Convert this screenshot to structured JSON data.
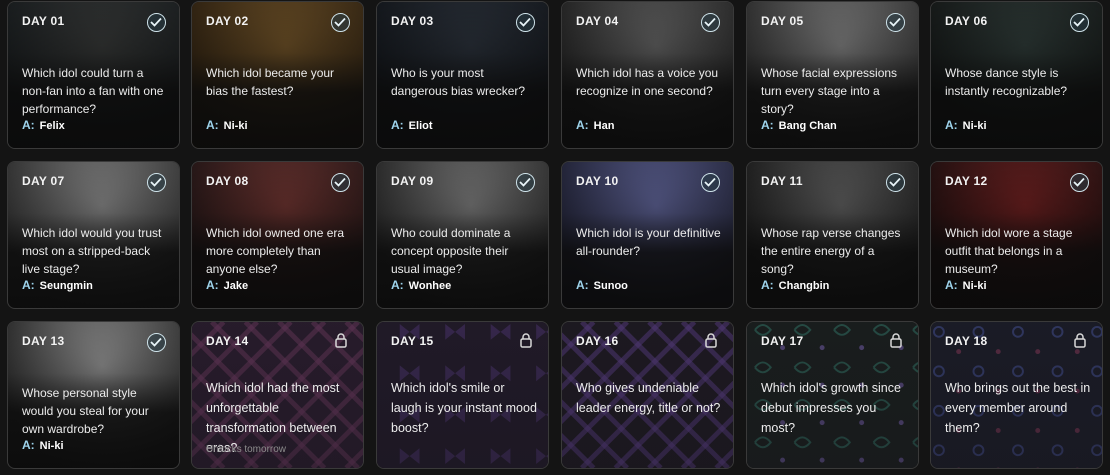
{
  "cards": [
    {
      "day": "DAY 01",
      "question": "Which idol could turn a non-fan into a fan with one performance?",
      "answer_label": "A:",
      "answer": "Felix",
      "status": "completed",
      "icon": "check-icon",
      "bg": "#3b3d3c",
      "bg2": "#1e2224"
    },
    {
      "day": "DAY 02",
      "question": "Which idol became your bias the fastest?",
      "answer_label": "A:",
      "answer": "Ni-ki",
      "status": "completed",
      "icon": "check-icon",
      "bg": "#7a5a2c",
      "bg2": "#3a2a16"
    },
    {
      "day": "DAY 03",
      "question": "Who is your most dangerous bias wrecker?",
      "answer_label": "A:",
      "answer": "Eliot",
      "status": "completed",
      "icon": "check-icon",
      "bg": "#2f3640",
      "bg2": "#181c22"
    },
    {
      "day": "DAY 04",
      "question": "Which idol has a voice you recognize in one second?",
      "answer_label": "A:",
      "answer": "Han",
      "status": "completed",
      "icon": "check-icon",
      "bg": "#6e6e6e",
      "bg2": "#2c2c2c"
    },
    {
      "day": "DAY 05",
      "question": "Whose facial expressions turn every stage into a story?",
      "answer_label": "A:",
      "answer": "Bang Chan",
      "status": "completed",
      "icon": "check-icon",
      "bg": "#8e8e8e",
      "bg2": "#3a3a3a"
    },
    {
      "day": "DAY 06",
      "question": "Whose dance style is instantly recognizable?",
      "answer_label": "A:",
      "answer": "Ni-ki",
      "status": "completed",
      "icon": "check-icon",
      "bg": "#33403d",
      "bg2": "#1a1e1d"
    },
    {
      "day": "DAY 07",
      "question": "Which idol would you trust most on a stripped-back live stage?",
      "answer_label": "A:",
      "answer": "Seungmin",
      "status": "completed",
      "icon": "check-icon",
      "bg": "#9a9a9a",
      "bg2": "#3e3e3e"
    },
    {
      "day": "DAY 08",
      "question": "Which idol owned one era more completely than anyone else?",
      "answer_label": "A:",
      "answer": "Jake",
      "status": "completed",
      "icon": "check-icon",
      "bg": "#7a3a36",
      "bg2": "#2e1c1c"
    },
    {
      "day": "DAY 09",
      "question": "Who could dominate a concept opposite their usual image?",
      "answer_label": "A:",
      "answer": "Wonhee",
      "status": "completed",
      "icon": "check-icon",
      "bg": "#8a8a8a",
      "bg2": "#343434"
    },
    {
      "day": "DAY 10",
      "question": "Which idol is your definitive all-rounder?",
      "answer_label": "A:",
      "answer": "Sunoo",
      "status": "completed",
      "icon": "check-icon",
      "bg": "#6a6fa8",
      "bg2": "#2a2c44"
    },
    {
      "day": "DAY 11",
      "question": "Whose rap verse changes the entire energy of a song?",
      "answer_label": "A:",
      "answer": "Changbin",
      "status": "completed",
      "icon": "check-icon",
      "bg": "#6a6a6a",
      "bg2": "#262626"
    },
    {
      "day": "DAY 12",
      "question": "Which idol wore a stage outfit that belongs in a museum?",
      "answer_label": "A:",
      "answer": "Ni-ki",
      "status": "completed",
      "icon": "check-icon",
      "bg": "#7a2424",
      "bg2": "#2a1414"
    },
    {
      "day": "DAY 13",
      "question": "Whose personal style would you steal for your own wardrobe?",
      "answer_label": "A:",
      "answer": "Ni-ki",
      "status": "completed",
      "icon": "check-icon",
      "bg": "#a8a8a8",
      "bg2": "#3a3a3a"
    },
    {
      "day": "DAY 14",
      "question": "Which idol had the most unforgettable transformation between eras?",
      "note": "Unlocks tomorrow",
      "status": "locked",
      "icon": "lock-icon",
      "pattern": "diamond",
      "bg": "#2a1d2e",
      "accent": "#6b3a5e"
    },
    {
      "day": "DAY 15",
      "question": "Which idol's smile or laugh is your instant mood boost?",
      "status": "locked",
      "icon": "lock-icon",
      "pattern": "bow",
      "bg": "#221b2a",
      "accent": "#5a3f86"
    },
    {
      "day": "DAY 16",
      "question": "Who gives undeniable leader energy, title or not?",
      "status": "locked",
      "icon": "lock-icon",
      "pattern": "lattice",
      "bg": "#1e1a22",
      "accent": "#5a3f86"
    },
    {
      "day": "DAY 17",
      "question": "Which idol's growth since debut impresses you most?",
      "status": "locked",
      "icon": "lock-icon",
      "pattern": "leaf",
      "bg": "#1a1f1e",
      "accent": "#2f6a5c"
    },
    {
      "day": "DAY 18",
      "question": "Who brings out the best in every member around them?",
      "status": "locked",
      "icon": "lock-icon",
      "pattern": "star",
      "bg": "#1b1d28",
      "accent": "#3f4a86"
    }
  ]
}
